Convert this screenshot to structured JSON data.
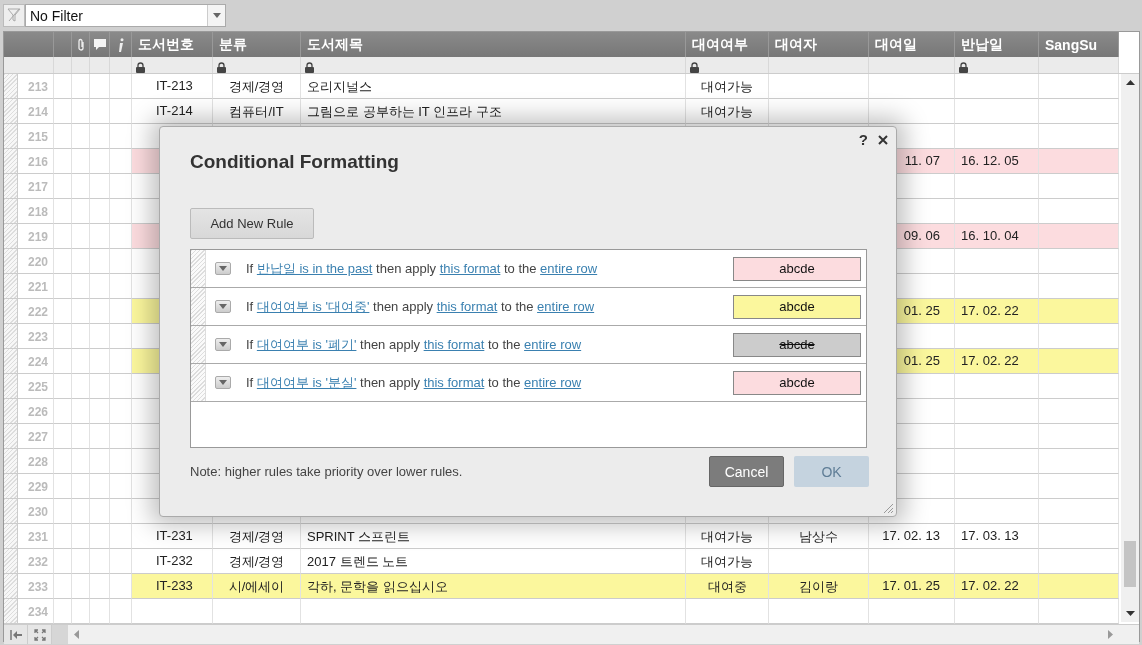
{
  "filter": {
    "value": "No Filter"
  },
  "columns": [
    {
      "label": "도서번호",
      "locked": true
    },
    {
      "label": "분류",
      "locked": true
    },
    {
      "label": "도서제목",
      "locked": true
    },
    {
      "label": "대여여부",
      "locked": true
    },
    {
      "label": "대여자",
      "locked": false
    },
    {
      "label": "대여일",
      "locked": false
    },
    {
      "label": "반납일",
      "locked": true
    },
    {
      "label": "SangSu",
      "locked": false
    }
  ],
  "rows": [
    {
      "num": "213",
      "id": "IT-213",
      "category": "경제/경영",
      "title": "오리지널스",
      "status": "대여가능"
    },
    {
      "num": "214",
      "id": "IT-214",
      "category": "컴퓨터/IT",
      "title": "그림으로 공부하는 IT 인프라 구조",
      "status": "대여가능"
    },
    {
      "num": "215"
    },
    {
      "num": "216",
      "color": "#fcdcdf",
      "loan_date": "11. 07",
      "return_date": "16. 12. 05"
    },
    {
      "num": "217"
    },
    {
      "num": "218"
    },
    {
      "num": "219",
      "color": "#fcdcdf",
      "loan_date": "09. 06",
      "return_date": "16. 10. 04"
    },
    {
      "num": "220"
    },
    {
      "num": "221"
    },
    {
      "num": "222",
      "color": "#fbf79d",
      "loan_date": "01. 25",
      "return_date": "17. 02. 22"
    },
    {
      "num": "223"
    },
    {
      "num": "224",
      "color": "#fbf79d",
      "loan_date": "01. 25",
      "return_date": "17. 02. 22"
    },
    {
      "num": "225"
    },
    {
      "num": "226"
    },
    {
      "num": "227"
    },
    {
      "num": "228"
    },
    {
      "num": "229"
    },
    {
      "num": "230"
    },
    {
      "num": "231",
      "id": "IT-231",
      "category": "경제/경영",
      "title": "SPRINT 스프린트",
      "status": "대여가능",
      "borrower": "남상수",
      "loan_date": "17. 02. 13",
      "return_date": "17. 03. 13"
    },
    {
      "num": "232",
      "id": "IT-232",
      "category": "경제/경영",
      "title": "2017 트렌드 노트",
      "status": "대여가능"
    },
    {
      "num": "233",
      "color": "#fbf79d",
      "id": "IT-233",
      "category": "시/에세이",
      "title": "각하, 문학을 읽으십시오",
      "status": "대여중",
      "borrower": "김이랑",
      "loan_date": "17. 01. 25",
      "return_date": "17. 02. 22"
    },
    {
      "num": "234"
    }
  ],
  "dialog": {
    "title": "Conditional Formatting",
    "help": "?",
    "add_button": "Add New Rule",
    "rules": [
      {
        "if_text": "If",
        "condition": "반납일 is in the past",
        "then_text": "then apply",
        "format_link": "this format",
        "to_text": "to the",
        "target_link": "entire row",
        "preview": {
          "text": "abcde",
          "color": "#fcdcdf",
          "strikethrough": false
        }
      },
      {
        "if_text": "If",
        "condition": "대여여부 is '대여중'",
        "then_text": "then apply",
        "format_link": "this format",
        "to_text": "to the",
        "target_link": "entire row",
        "preview": {
          "text": "abcde",
          "color": "#fbf79d",
          "strikethrough": false
        }
      },
      {
        "if_text": "If",
        "condition": "대여여부 is '폐기'",
        "then_text": "then apply",
        "format_link": "this format",
        "to_text": "to the",
        "target_link": "entire row",
        "preview": {
          "text": "abcde",
          "color": "#cccccc",
          "strikethrough": true
        }
      },
      {
        "if_text": "If",
        "condition": "대여여부 is '분실'",
        "then_text": "then apply",
        "format_link": "this format",
        "to_text": "to the",
        "target_link": "entire row",
        "preview": {
          "text": "abcde",
          "color": "#fcdcdf",
          "strikethrough": false
        }
      }
    ],
    "note": "Note: higher rules take priority over lower rules.",
    "cancel": {
      "label": "Cancel",
      "disabled": false
    },
    "ok": {
      "label": "OK",
      "disabled": true
    }
  }
}
